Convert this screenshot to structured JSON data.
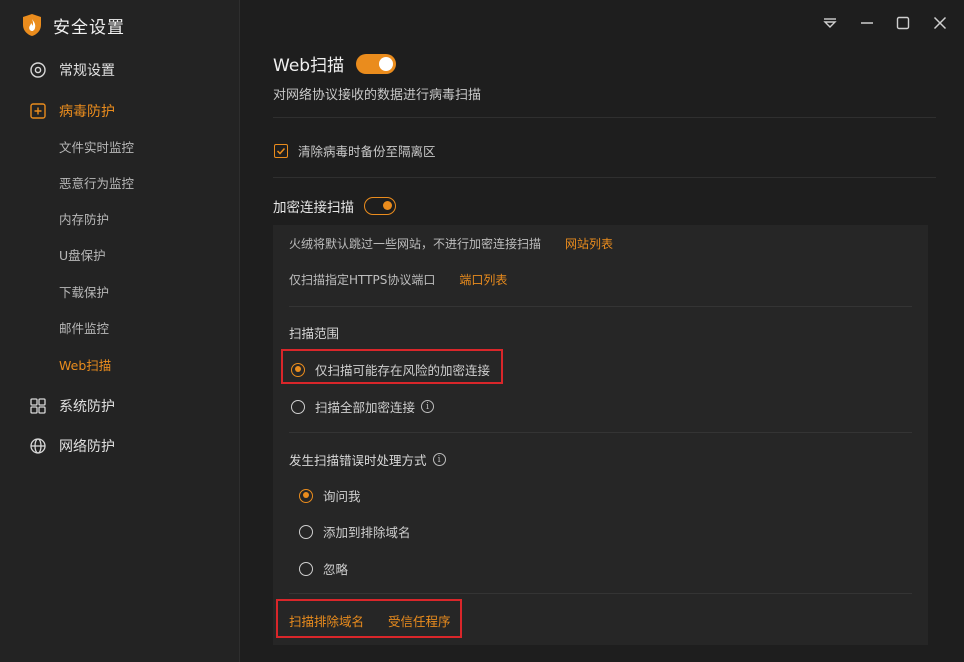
{
  "app": {
    "title": "安全设置",
    "logo_icon": "shield-flame-icon"
  },
  "sidebar": {
    "items": [
      {
        "label": "常规设置",
        "icon": "gear-icon"
      },
      {
        "label": "病毒防护",
        "icon": "plus-box-icon"
      },
      {
        "label": "系统防护",
        "icon": "grid-icon"
      },
      {
        "label": "网络防护",
        "icon": "globe-icon"
      }
    ],
    "sub_items": [
      "文件实时监控",
      "恶意行为监控",
      "内存防护",
      "U盘保护",
      "下载保护",
      "邮件监控",
      "Web扫描"
    ],
    "active_item": "病毒防护",
    "active_sub_item": "Web扫描"
  },
  "titlebar": {
    "icons": [
      "dropdown-menu-icon",
      "minimize-icon",
      "maximize-icon",
      "close-icon"
    ]
  },
  "main": {
    "web_title": "Web扫描",
    "web_toggle_on": true,
    "web_desc": "对网络协议接收的数据进行病毒扫描",
    "backup_checkbox_label": "清除病毒时备份至隔离区",
    "backup_checked": true,
    "enc_title": "加密连接扫描",
    "enc_toggle_on": true,
    "skip_sites_text": "火绒将默认跳过一些网站，不进行加密连接扫描",
    "site_list_link": "网站列表",
    "https_ports_text": "仅扫描指定HTTPS协议端口",
    "port_list_link": "端口列表",
    "scope_title": "扫描范围",
    "scope_options": [
      "仅扫描可能存在风险的加密连接",
      "扫描全部加密连接"
    ],
    "scope_selected": 0,
    "error_title": "发生扫描错误时处理方式",
    "error_options": [
      "询问我",
      "添加到排除域名",
      "忽略"
    ],
    "error_selected": 0,
    "excluded_domains_link": "扫描排除域名",
    "trusted_programs_link": "受信任程序",
    "info_icon_char": "i"
  },
  "colors": {
    "accent": "#ea8c1d",
    "highlight_box": "#d9262a",
    "background": "#1e1e1e",
    "sidebar": "#232323",
    "panel": "#262626"
  }
}
